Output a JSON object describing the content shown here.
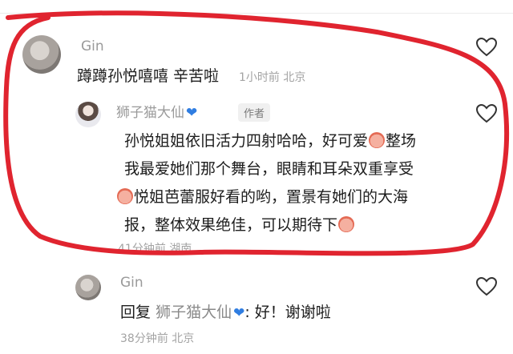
{
  "comment1": {
    "user": "Gin",
    "text": "蹲蹲孙悦嘻嘻 辛苦啦",
    "meta": "1小时前 北京"
  },
  "reply1": {
    "user": "狮子猫大仙",
    "user_icon": "blue-heart",
    "badge": "作者",
    "lines": [
      "孙悦姐姐依旧活力四射哈哈，好可爱",
      "整场",
      "我最爱她们那个舞台，眼睛和耳朵双重享受",
      "悦姐芭蕾服好看的哟，置景有她们的大海",
      "报，整体效果绝佳，可以期待下"
    ],
    "meta": "41分钟前 湖南"
  },
  "reply2": {
    "user": "Gin",
    "prefix": "回复",
    "target": "狮子猫大仙",
    "text": ": 好！谢谢啦",
    "meta": "38分钟前 北京"
  },
  "colors": {
    "annotation": "#e0242f",
    "blue_heart": "#2f7de1"
  }
}
